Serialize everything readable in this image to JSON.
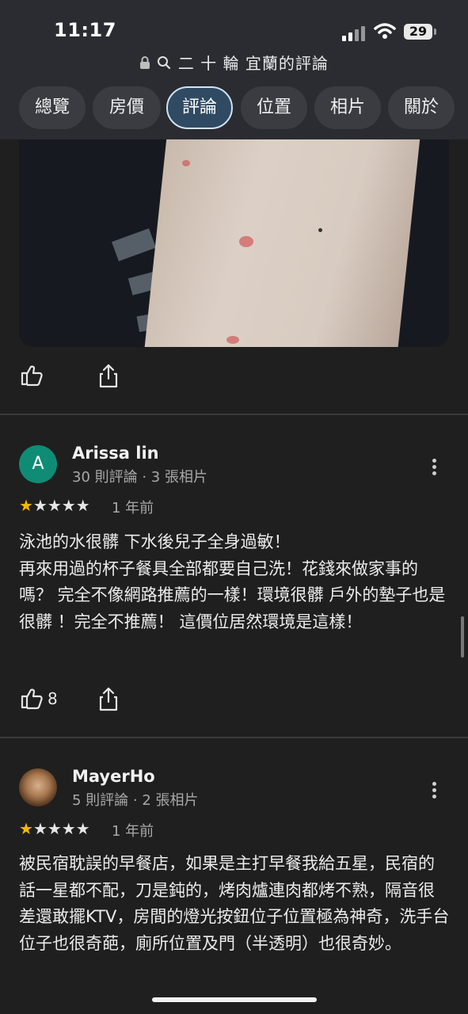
{
  "status": {
    "time": "11:17",
    "battery": "29"
  },
  "url": {
    "text": "二 十 輪 宜蘭的評論"
  },
  "tabs": [
    {
      "label": "總覽"
    },
    {
      "label": "房價"
    },
    {
      "label": "評論",
      "active": true
    },
    {
      "label": "位置"
    },
    {
      "label": "相片"
    },
    {
      "label": "關於"
    }
  ],
  "reviews": [
    {
      "initial": "A",
      "name": "Arissa lin",
      "meta": "30 則評論 · 3 張相片",
      "rating": 1,
      "ago": "1 年前",
      "text": "泳池的水很髒 下水後兒子全身過敏！\n再來用過的杯子餐具全部都要自己洗！花錢來做家事的嗎？ 完全不像網路推薦的一樣！環境很髒 戶外的墊子也是很髒 ！完全不推薦！ 這價位居然環境是這樣！",
      "likes": "8"
    },
    {
      "name": "MayerHo",
      "meta": "5 則評論 · 2 張相片",
      "rating": 1,
      "ago": "1 年前",
      "text": "被民宿耽誤的早餐店，如果是主打早餐我給五星，民宿的話一星都不配，刀是鈍的，烤肉爐連肉都烤不熟，隔音很差還敢擺KTV，房間的燈光按鈕位子位置極為神奇，洗手台位子也很奇葩，廁所位置及門（半透明）也很奇妙。"
    }
  ],
  "colors": {
    "star": "#f6b900",
    "avatar_a": "#0f8c75",
    "active_tab": "#2f4a62"
  }
}
